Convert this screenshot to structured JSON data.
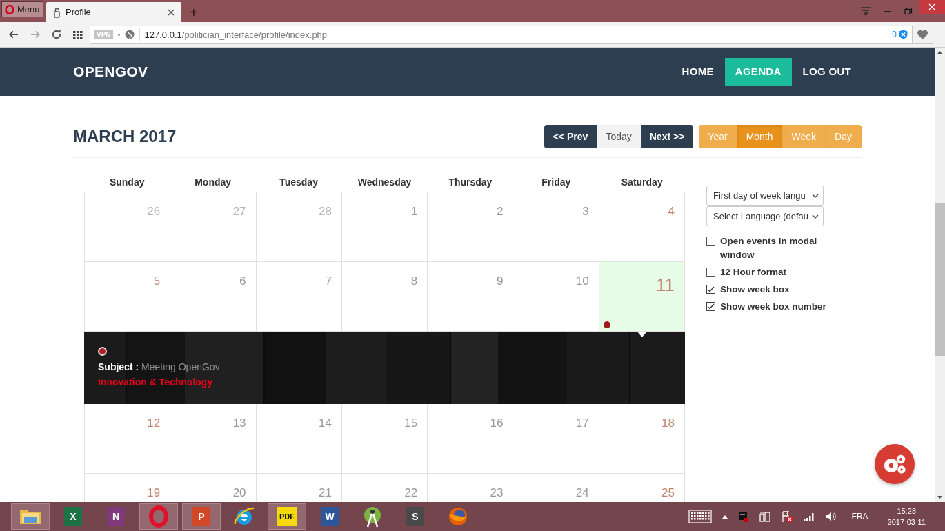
{
  "browser": {
    "menu_label": "Menu",
    "tabs": [
      {
        "title": "Profile",
        "selected": true
      }
    ],
    "new_tab_label": "+",
    "address": {
      "vpn_badge": "VPN",
      "host": "127.0.0.1",
      "path": "/politician_interface/profile/index.php",
      "blocked_count": "0"
    }
  },
  "navbar": {
    "brand": "OPENGOV",
    "links": [
      {
        "label": "HOME",
        "selected": false
      },
      {
        "label": "AGENDA",
        "selected": true
      },
      {
        "label": "LOG OUT",
        "selected": false
      }
    ]
  },
  "calendar": {
    "title": "MARCH 2017",
    "nav_buttons": [
      {
        "label": "<< Prev",
        "kind": "dark"
      },
      {
        "label": "Today",
        "kind": "light"
      },
      {
        "label": "Next >>",
        "kind": "dark"
      }
    ],
    "view_buttons": [
      {
        "label": "Year",
        "selected": false
      },
      {
        "label": "Month",
        "selected": true
      },
      {
        "label": "Week",
        "selected": false
      },
      {
        "label": "Day",
        "selected": false
      }
    ],
    "weekdays": [
      "Sunday",
      "Monday",
      "Tuesday",
      "Wednesday",
      "Thursday",
      "Friday",
      "Saturday"
    ],
    "weeks": [
      {
        "days": [
          {
            "label": "26",
            "muted": true,
            "today": false,
            "has_event": false
          },
          {
            "label": "27",
            "muted": true,
            "today": false,
            "has_event": false
          },
          {
            "label": "28",
            "muted": true,
            "today": false,
            "has_event": false
          },
          {
            "label": "1",
            "muted": false,
            "today": false,
            "has_event": false
          },
          {
            "label": "2",
            "muted": false,
            "today": false,
            "has_event": false
          },
          {
            "label": "3",
            "muted": false,
            "today": false,
            "has_event": false
          },
          {
            "label": "4",
            "muted": false,
            "today": false,
            "has_event": false
          }
        ]
      },
      {
        "days": [
          {
            "label": "5",
            "muted": false,
            "today": false,
            "has_event": false
          },
          {
            "label": "6",
            "muted": false,
            "today": false,
            "has_event": false
          },
          {
            "label": "7",
            "muted": false,
            "today": false,
            "has_event": false
          },
          {
            "label": "8",
            "muted": false,
            "today": false,
            "has_event": false
          },
          {
            "label": "9",
            "muted": false,
            "today": false,
            "has_event": false
          },
          {
            "label": "10",
            "muted": false,
            "today": false,
            "has_event": false
          },
          {
            "label": "11",
            "muted": false,
            "today": true,
            "has_event": true
          }
        ],
        "event_panel": {
          "events": [
            {
              "subject_label": "Subject :",
              "subject": "Meeting OpenGov",
              "category": "Innovation & Technology"
            }
          ]
        }
      },
      {
        "days": [
          {
            "label": "12",
            "muted": false,
            "today": false,
            "has_event": false
          },
          {
            "label": "13",
            "muted": false,
            "today": false,
            "has_event": false
          },
          {
            "label": "14",
            "muted": false,
            "today": false,
            "has_event": false
          },
          {
            "label": "15",
            "muted": false,
            "today": false,
            "has_event": false
          },
          {
            "label": "16",
            "muted": false,
            "today": false,
            "has_event": false
          },
          {
            "label": "17",
            "muted": false,
            "today": false,
            "has_event": false
          },
          {
            "label": "18",
            "muted": false,
            "today": false,
            "has_event": false
          }
        ]
      },
      {
        "days": [
          {
            "label": "19",
            "muted": false,
            "today": false
          },
          {
            "label": "20",
            "muted": false,
            "today": false
          },
          {
            "label": "21",
            "muted": false,
            "today": false
          },
          {
            "label": "22",
            "muted": false,
            "today": false
          },
          {
            "label": "23",
            "muted": false,
            "today": false
          },
          {
            "label": "24",
            "muted": false,
            "today": false
          },
          {
            "label": "25",
            "muted": false,
            "today": false
          }
        ]
      }
    ]
  },
  "options": {
    "selects": [
      "First day of week langu",
      "Select Language (defau"
    ],
    "checkboxes": [
      {
        "label": "Open events in modal window",
        "checked": false
      },
      {
        "label": "12 Hour format",
        "checked": false
      },
      {
        "label": "Show week box",
        "checked": true
      },
      {
        "label": "Show week box number",
        "checked": true
      }
    ]
  },
  "taskbar": {
    "apps": [
      {
        "kind": "folder",
        "active": true
      },
      {
        "kind": "excel",
        "label": "X",
        "active": false
      },
      {
        "kind": "onenote",
        "label": "N",
        "active": false
      },
      {
        "kind": "opera",
        "active": true
      },
      {
        "kind": "powerpoint",
        "label": "P",
        "active": true
      },
      {
        "kind": "ie",
        "active": false
      },
      {
        "kind": "pdf",
        "label": "PDF",
        "active": true
      },
      {
        "kind": "word",
        "label": "W",
        "active": false
      },
      {
        "kind": "android",
        "active": false
      },
      {
        "kind": "sublime",
        "label": "S",
        "active": false
      },
      {
        "kind": "firefox",
        "active": false
      }
    ],
    "language": "FRA",
    "time": "15:28",
    "date": "2017-03-11"
  }
}
